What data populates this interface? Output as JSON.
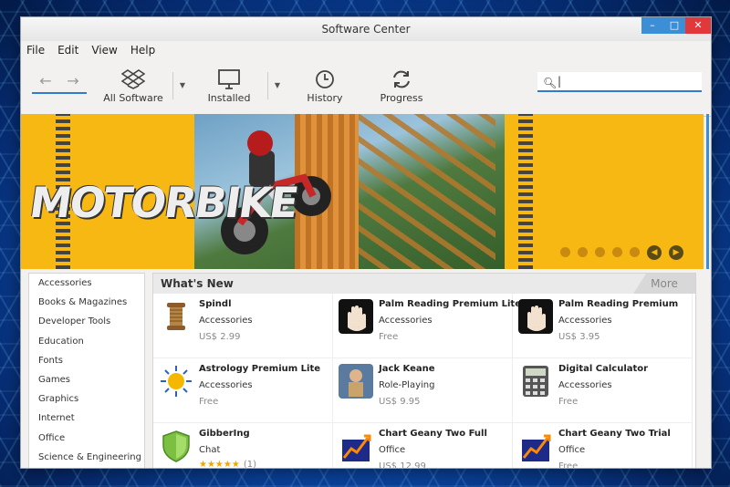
{
  "window": {
    "title": "Software Center"
  },
  "menu": [
    "File",
    "Edit",
    "View",
    "Help"
  ],
  "toolbar": {
    "all_software": "All Software",
    "installed": "Installed",
    "history": "History",
    "progress": "Progress",
    "search_value": ""
  },
  "banner": {
    "logo_text": "MOTORBIKE"
  },
  "categories": [
    "Accessories",
    "Books & Magazines",
    "Developer Tools",
    "Education",
    "Fonts",
    "Games",
    "Graphics",
    "Internet",
    "Office",
    "Science & Engineering"
  ],
  "whats_new": {
    "title": "What's New",
    "more_label": "More",
    "apps": [
      {
        "name": "Spindl",
        "category": "Accessories",
        "price": "US$ 2.99",
        "icon": "spool-icon"
      },
      {
        "name": "Palm Reading Premium Lite",
        "category": "Accessories",
        "price": "Free",
        "icon": "palm-icon"
      },
      {
        "name": "Palm Reading Premium",
        "category": "Accessories",
        "price": "US$ 3.95",
        "icon": "palm-icon"
      },
      {
        "name": "Astrology Premium Lite",
        "category": "Accessories",
        "price": "Free",
        "icon": "sun-icon"
      },
      {
        "name": "Jack Keane",
        "category": "Role-Playing",
        "price": "US$ 9.95",
        "icon": "jack-keane-icon"
      },
      {
        "name": "Digital Calculator",
        "category": "Accessories",
        "price": "Free",
        "icon": "calculator-icon"
      },
      {
        "name": "GibberIng",
        "category": "Chat",
        "rating": "★★★★★",
        "rating_count": "(1)",
        "icon": "shield-icon"
      },
      {
        "name": "Chart Geany Two Full",
        "category": "Office",
        "price": "US$ 12.99",
        "icon": "chart-icon"
      },
      {
        "name": "Chart Geany Two Trial",
        "category": "Office",
        "price": "Free",
        "icon": "chart-icon"
      }
    ]
  }
}
